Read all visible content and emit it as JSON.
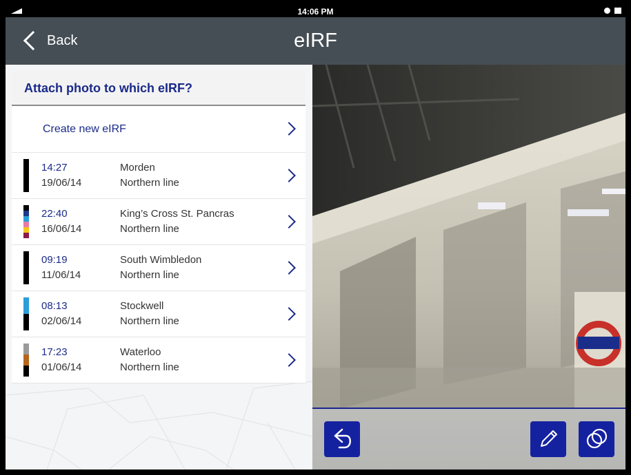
{
  "status_bar": {
    "time": "14:06 PM"
  },
  "nav": {
    "back_label": "Back",
    "title": "eIRF"
  },
  "panel": {
    "title": "Attach photo to which eIRF?",
    "create_label": "Create new eIRF"
  },
  "entries": [
    {
      "time": "14:27",
      "date": "19/06/14",
      "station": "Morden",
      "line": "Northern line",
      "stripe": [
        "#000000"
      ]
    },
    {
      "time": "22:40",
      "date": "16/06/14",
      "station": "King’s Cross St. Pancras",
      "line": "Northern line",
      "stripe": [
        "#000000",
        "#1a3a8c",
        "#2a9ed8",
        "#e87aa8",
        "#f5c518",
        "#8b1a4a"
      ]
    },
    {
      "time": "09:19",
      "date": "11/06/14",
      "station": "South Wimbledon",
      "line": "Northern line",
      "stripe": [
        "#000000"
      ]
    },
    {
      "time": "08:13",
      "date": "02/06/14",
      "station": "Stockwell",
      "line": "Northern line",
      "stripe": [
        "#2a9ed8",
        "#000000"
      ]
    },
    {
      "time": "17:23",
      "date": "01/06/14",
      "station": "Waterloo",
      "line": "Northern line",
      "stripe": [
        "#9a9a9a",
        "#b5651d",
        "#000000"
      ]
    }
  ],
  "toolbar": {
    "undo_icon": "undo-icon",
    "edit_icon": "pencil-icon",
    "overlay_icon": "circles-icon"
  },
  "colors": {
    "navbar": "#464e55",
    "accent": "#1522a0",
    "link": "#1a2a8a"
  }
}
